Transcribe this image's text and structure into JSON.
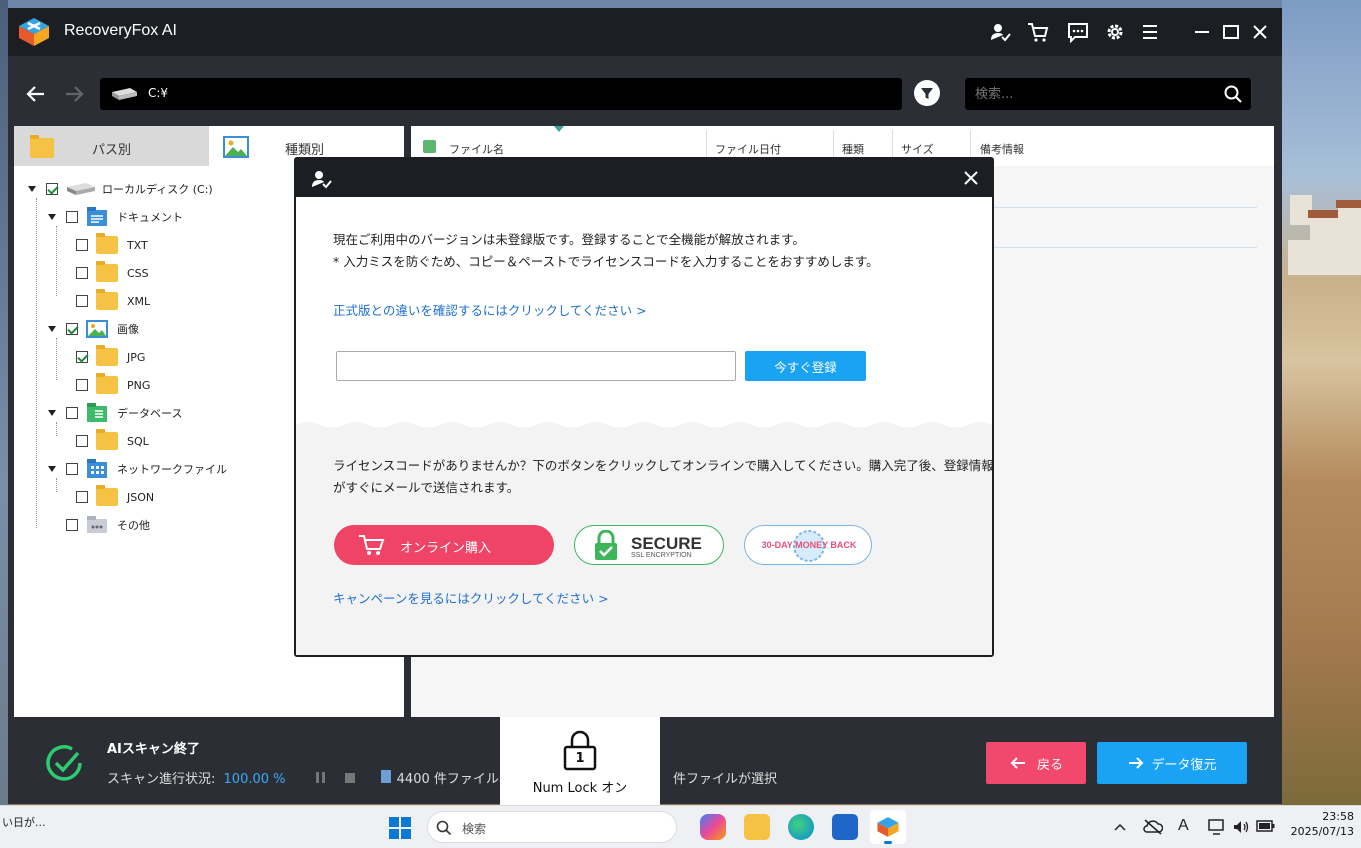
{
  "app": {
    "title": "RecoveryFox AI"
  },
  "toolbar": {
    "path": "C:¥",
    "search_placeholder": "検索..."
  },
  "tabs": {
    "path_label": "パス別",
    "type_label": "種類別"
  },
  "tree": {
    "root": "ローカルディスク (C:)",
    "documents": "ドキュメント",
    "txt": "TXT",
    "css": "CSS",
    "xml": "XML",
    "images": "画像",
    "jpg": "JPG",
    "png": "PNG",
    "database": "データベース",
    "sql": "SQL",
    "network": "ネットワークファイル",
    "json": "JSON",
    "other": "その他"
  },
  "columns": {
    "name": "ファイル名",
    "date": "ファイル日付",
    "type": "種類",
    "size": "サイズ",
    "notes": "備考情報"
  },
  "dialog": {
    "line1": "現在ご利用中のバージョンは未登録版です。登録することで全機能が解放されます。",
    "line2": "* 入力ミスを防ぐため、コピー＆ペーストでライセンスコードを入力することをおすすめします。",
    "compare_link": "正式版との違いを確認するにはクリックしてください >",
    "register_button": "今すぐ登録",
    "no_license_line1": "ライセンスコードがありませんか？下のボタンをクリックしてオンラインで購入してください。購入完了後、登録情報",
    "no_license_line2": "がすぐにメールで送信されます。",
    "buy_button": "オンライン購入",
    "secure_title": "SECURE",
    "secure_sub": "SSL ENCRYPTION",
    "money_back": "30-DAY MONEY BACK",
    "campaign_link": "キャンペーンを見るにはクリックしてください >"
  },
  "status": {
    "title": "AIスキャン終了",
    "progress_label": "スキャン進行状況:",
    "progress_value": "100.00 %",
    "found_text": "4400 件ファイルが",
    "selected_text": "件ファイルが選択",
    "back_button": "戻る",
    "recover_button": "データ復元"
  },
  "osd": {
    "numlock_label": "Num Lock オン",
    "numlock_key": "1"
  },
  "taskbar": {
    "weather": "い日が...",
    "search_label": "検索",
    "time": "23:58",
    "date": "2025/07/13"
  },
  "colors": {
    "accent_blue": "#1aa3f5",
    "accent_pink": "#f2486d",
    "link_blue": "#1f6fd1",
    "dark_bg": "#2b2f35"
  }
}
